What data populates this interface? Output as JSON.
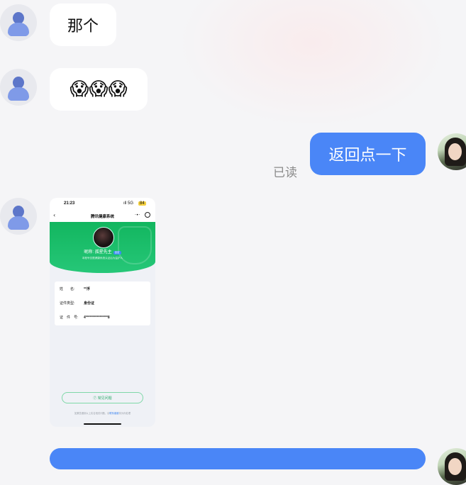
{
  "messages": [
    {
      "side": "in",
      "text": "那个"
    },
    {
      "side": "in",
      "text": "😱😱😱"
    },
    {
      "side": "out",
      "text": "返回点一下",
      "status": "已读"
    },
    {
      "side": "in",
      "type": "image"
    }
  ],
  "screenshot": {
    "status_time": "21:23",
    "status_net": "ıll 5G",
    "status_battery": "84",
    "nav_back": "‹",
    "nav_title": "腾讯健康系统",
    "nav_more": "·•·",
    "nav_close": "◉",
    "nickname": "昵称: 孤星先主",
    "nickname_tag": "自定",
    "banner_sub": "本账号仅限健康系统认证后为监护人",
    "fields": [
      {
        "label": "姓　　名:",
        "value": "**浮"
      },
      {
        "label": "证件类型:",
        "value": "身份证"
      },
      {
        "label": "证　件　号:",
        "value": "4****************8"
      }
    ],
    "faq_label": "⑦ 常见问题",
    "footer_text": "如果您遇到以上实名相关问题，请",
    "footer_link": "联系客服",
    "footer_tail": "将为你处理"
  },
  "colors": {
    "outgoing_bubble": "#4a86f7",
    "incoming_bubble": "#ffffff",
    "banner_green": "#12b65f"
  }
}
